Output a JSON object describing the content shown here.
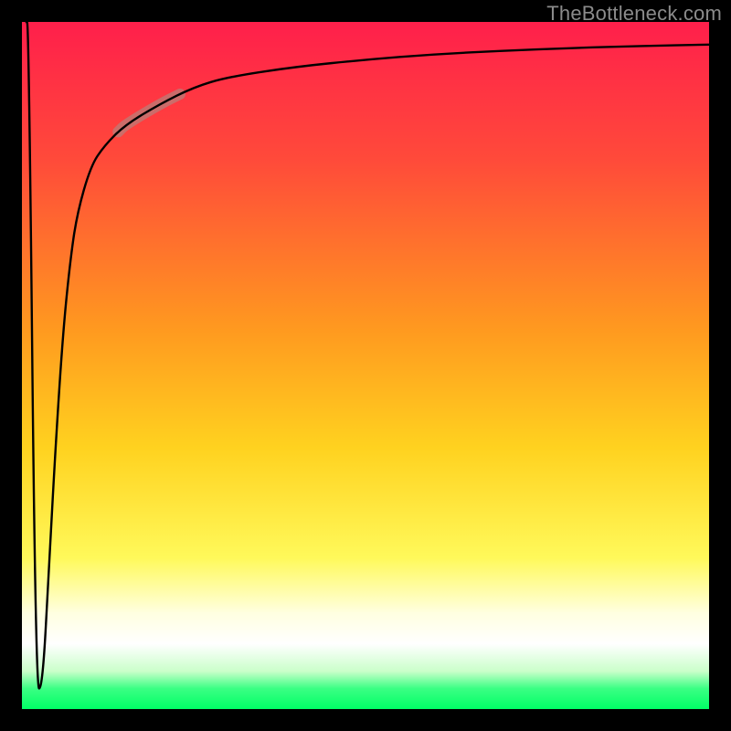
{
  "watermark": "TheBottleneck.com",
  "colors": {
    "frame": "#000000",
    "gradient_stops": [
      {
        "offset": 0.0,
        "color": "#ff1f4b"
      },
      {
        "offset": 0.2,
        "color": "#ff4a3a"
      },
      {
        "offset": 0.45,
        "color": "#ff9a1f"
      },
      {
        "offset": 0.62,
        "color": "#ffd21f"
      },
      {
        "offset": 0.78,
        "color": "#fff95a"
      },
      {
        "offset": 0.86,
        "color": "#ffffe0"
      },
      {
        "offset": 0.905,
        "color": "#ffffff"
      },
      {
        "offset": 0.945,
        "color": "#caffca"
      },
      {
        "offset": 0.97,
        "color": "#3bff84"
      },
      {
        "offset": 1.0,
        "color": "#00ff66"
      }
    ],
    "curve": "#000000",
    "highlight": "#b97e78"
  },
  "chart_data": {
    "type": "line",
    "title": "",
    "xlabel": "",
    "ylabel": "",
    "xlim": [
      0,
      100
    ],
    "ylim": [
      0,
      100
    ],
    "grid": false,
    "series": [
      {
        "name": "bottleneck-curve",
        "x": [
          0.5,
          1,
          2,
          3,
          4,
          5,
          6,
          7,
          8,
          10,
          12,
          15,
          20,
          25,
          30,
          40,
          50,
          60,
          70,
          80,
          90,
          100
        ],
        "y": [
          100,
          100,
          3,
          3,
          22,
          40,
          55,
          65,
          72,
          79,
          82,
          85,
          88,
          90.5,
          92,
          93.5,
          94.5,
          95.3,
          95.8,
          96.2,
          96.5,
          96.7
        ]
      }
    ],
    "annotations": [
      {
        "name": "highlight-segment",
        "x_range": [
          14,
          23
        ],
        "note": "thicker light-brown overlay on curve"
      }
    ]
  }
}
